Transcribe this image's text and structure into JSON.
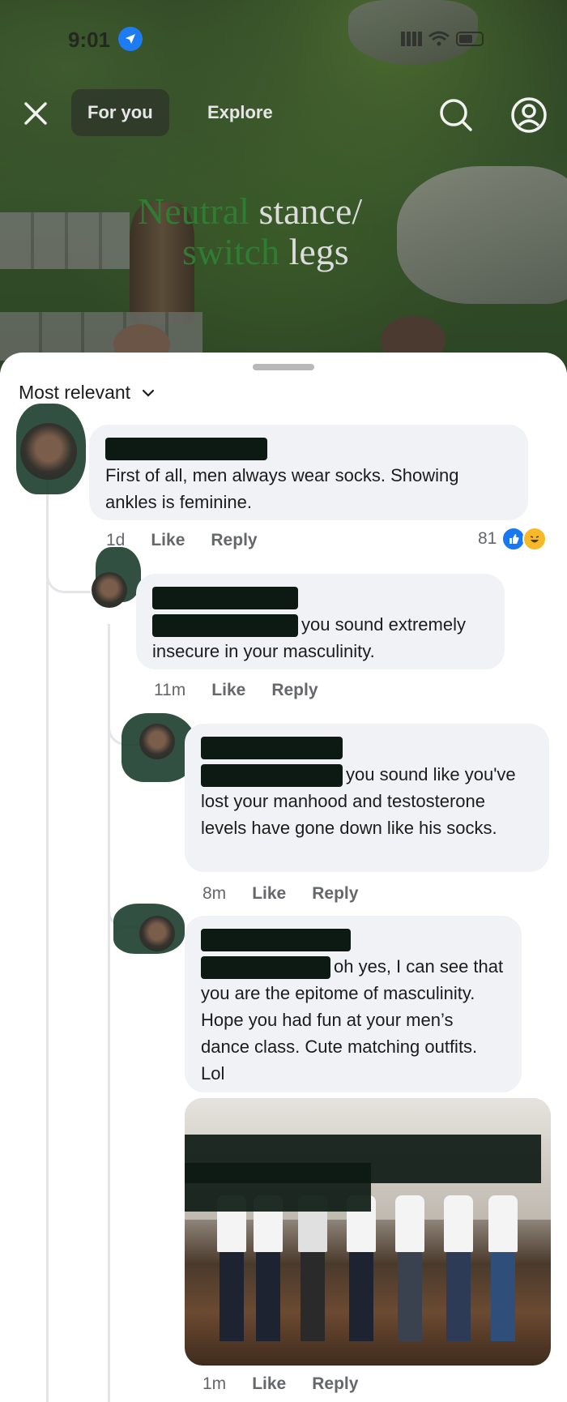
{
  "status_bar": {
    "time": "9:01"
  },
  "header": {
    "tabs": [
      "For you",
      "Explore"
    ],
    "active_tab": "For you"
  },
  "video": {
    "caption_part1": "Neutral",
    "caption_part2": " stance/",
    "caption_part3": "switch",
    "caption_part4": " legs"
  },
  "sheet": {
    "sort_label": "Most relevant"
  },
  "comments": [
    {
      "text": "First of all, men always wear socks. Showing ankles is feminine.",
      "time": "1d",
      "like_label": "Like",
      "reply_label": "Reply",
      "reaction_count": "81",
      "reactions": [
        "like",
        "haha"
      ]
    },
    {
      "text": "you sound extremely insecure in your masculinity.",
      "time": "11m",
      "like_label": "Like",
      "reply_label": "Reply"
    },
    {
      "text": "you sound like you've lost your manhood and testosterone levels have gone down like his socks.",
      "time": "8m",
      "like_label": "Like",
      "reply_label": "Reply"
    },
    {
      "text": "oh yes, I can see that you are the epitome of masculinity. Hope you had fun at your men’s dance class. Cute matching outfits. Lol",
      "time": "1m",
      "like_label": "Like",
      "reply_label": "Reply"
    }
  ],
  "colors": {
    "bubble_bg": "#f0f2f5",
    "meta_text": "#65676b",
    "like_blue": "#1877f2",
    "haha_yellow": "#f7b928",
    "redaction": "#0d1a14"
  }
}
